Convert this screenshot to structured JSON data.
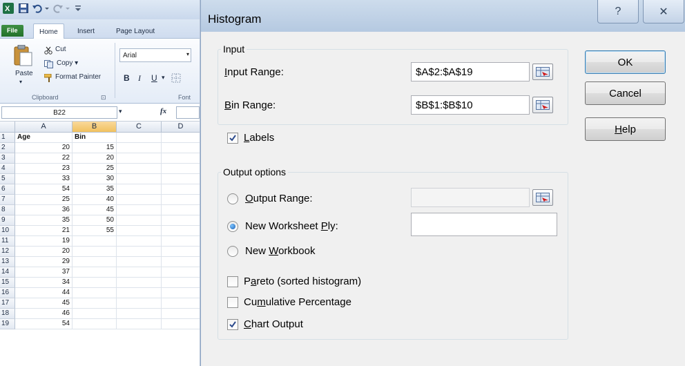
{
  "excel": {
    "tabs": [
      "File",
      "Home",
      "Insert",
      "Page Layout"
    ],
    "clipboard": {
      "paste_label": "Paste",
      "cut_label": "Cut",
      "copy_label": "Copy ▾",
      "format_painter_label": "Format Painter",
      "group_label": "Clipboard",
      "launcher_glyph": "⊡"
    },
    "font": {
      "name": "Arial",
      "bold": "B",
      "italic": "I",
      "underline": "U",
      "group_label": "Font"
    },
    "name_box": "B22",
    "fx_label": "fx",
    "columns": [
      "A",
      "B",
      "C",
      "D"
    ],
    "rows": [
      {
        "n": "1",
        "a": "Age",
        "b": "Bin"
      },
      {
        "n": "2",
        "a": "20",
        "b": "15"
      },
      {
        "n": "3",
        "a": "22",
        "b": "20"
      },
      {
        "n": "4",
        "a": "23",
        "b": "25"
      },
      {
        "n": "5",
        "a": "33",
        "b": "30"
      },
      {
        "n": "6",
        "a": "54",
        "b": "35"
      },
      {
        "n": "7",
        "a": "25",
        "b": "40"
      },
      {
        "n": "8",
        "a": "36",
        "b": "45"
      },
      {
        "n": "9",
        "a": "35",
        "b": "50"
      },
      {
        "n": "10",
        "a": "21",
        "b": "55"
      },
      {
        "n": "11",
        "a": "19",
        "b": ""
      },
      {
        "n": "12",
        "a": "20",
        "b": ""
      },
      {
        "n": "13",
        "a": "29",
        "b": ""
      },
      {
        "n": "14",
        "a": "37",
        "b": ""
      },
      {
        "n": "15",
        "a": "34",
        "b": ""
      },
      {
        "n": "16",
        "a": "44",
        "b": ""
      },
      {
        "n": "17",
        "a": "45",
        "b": ""
      },
      {
        "n": "18",
        "a": "46",
        "b": ""
      },
      {
        "n": "19",
        "a": "54",
        "b": ""
      }
    ]
  },
  "dialog": {
    "title": "Histogram",
    "help_glyph": "?",
    "close_glyph": "✕",
    "input": {
      "group_label": "Input",
      "input_range_label_u": "I",
      "input_range_label_rest": "nput Range:",
      "input_range_value": "$A$2:$A$19",
      "bin_range_label_u": "B",
      "bin_range_label_rest": "in Range:",
      "bin_range_value": "$B$1:$B$10"
    },
    "labels_check": {
      "label_u": "L",
      "label_rest": "abels",
      "checked": true
    },
    "output": {
      "group_label": "Output options",
      "output_range": {
        "label_u": "O",
        "label_rest": "utput Range:",
        "value": "",
        "selected": false
      },
      "new_ply": {
        "label_pre": "New Worksheet ",
        "label_u": "P",
        "label_post": "ly:",
        "value": "",
        "selected": true
      },
      "new_workbook": {
        "label_pre": "New ",
        "label_u": "W",
        "label_post": "orkbook",
        "selected": false
      },
      "pareto": {
        "label_pre": "P",
        "label_u": "a",
        "label_post": "reto (sorted histogram)",
        "checked": false
      },
      "cumulative": {
        "label_pre": "Cu",
        "label_u": "m",
        "label_post": "ulative Percentage",
        "checked": false
      },
      "chart_output": {
        "label_u": "C",
        "label_rest": "hart Output",
        "checked": true
      }
    },
    "buttons": {
      "ok": "OK",
      "cancel": "Cancel",
      "help_u": "H",
      "help_rest": "elp"
    }
  }
}
